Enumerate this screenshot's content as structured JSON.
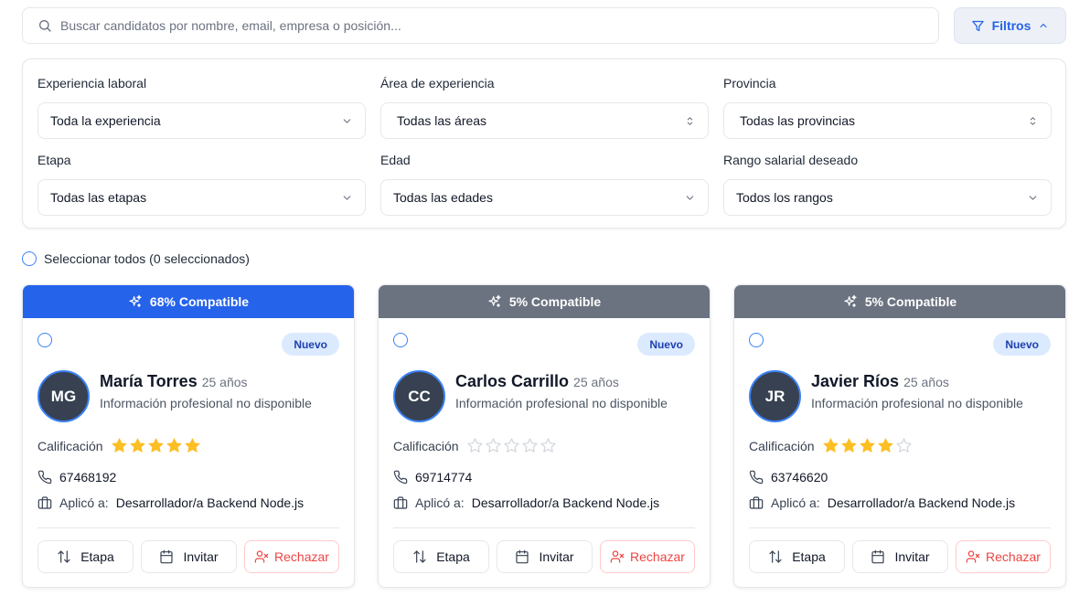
{
  "search": {
    "placeholder": "Buscar candidatos por nombre, email, empresa o posición..."
  },
  "filters_button": {
    "label": "Filtros"
  },
  "filters": [
    {
      "label": "Experiencia laboral",
      "value": "Toda la experiencia",
      "icon": "chevron-down-icon"
    },
    {
      "label": "Área de experiencia",
      "value": "Todas las áreas",
      "icon": "chevrons-up-down-icon"
    },
    {
      "label": "Provincia",
      "value": "Todas las provincias",
      "icon": "chevrons-up-down-icon"
    },
    {
      "label": "Etapa",
      "value": "Todas las etapas",
      "icon": "chevron-down-icon"
    },
    {
      "label": "Edad",
      "value": "Todas las edades",
      "icon": "chevron-down-icon"
    },
    {
      "label": "Rango salarial deseado",
      "value": "Todos los rangos",
      "icon": "chevron-down-icon"
    }
  ],
  "select_all": {
    "label": "Seleccionar todos (0 seleccionados)"
  },
  "rating_label": "Calificación",
  "applied_prefix": "Aplicó a:",
  "actions": {
    "stage": "Etapa",
    "invite": "Invitar",
    "reject": "Rechazar"
  },
  "colors": {
    "accent": "#2563eb",
    "header_high": "#2563eb",
    "header_low": "#6b7280",
    "star": "#fbbf24",
    "reject": "#ef4444"
  },
  "candidates": [
    {
      "compat": "68% Compatible",
      "compat_value": 68,
      "header_color": "#2563eb",
      "badge": "Nuevo",
      "initials": "MG",
      "name": "María Torres",
      "age": "25 años",
      "info": "Información profesional no disponible",
      "rating": 5,
      "phone": "67468192",
      "position": "Desarrollador/a Backend Node.js"
    },
    {
      "compat": "5% Compatible",
      "compat_value": 5,
      "header_color": "#6b7280",
      "badge": "Nuevo",
      "initials": "CC",
      "name": "Carlos Carrillo",
      "age": "25 años",
      "info": "Información profesional no disponible",
      "rating": 0,
      "phone": "69714774",
      "position": "Desarrollador/a Backend Node.js"
    },
    {
      "compat": "5% Compatible",
      "compat_value": 5,
      "header_color": "#6b7280",
      "badge": "Nuevo",
      "initials": "JR",
      "name": "Javier Ríos",
      "age": "25 años",
      "info": "Información profesional no disponible",
      "rating": 4,
      "phone": "63746620",
      "position": "Desarrollador/a Backend Node.js"
    }
  ]
}
